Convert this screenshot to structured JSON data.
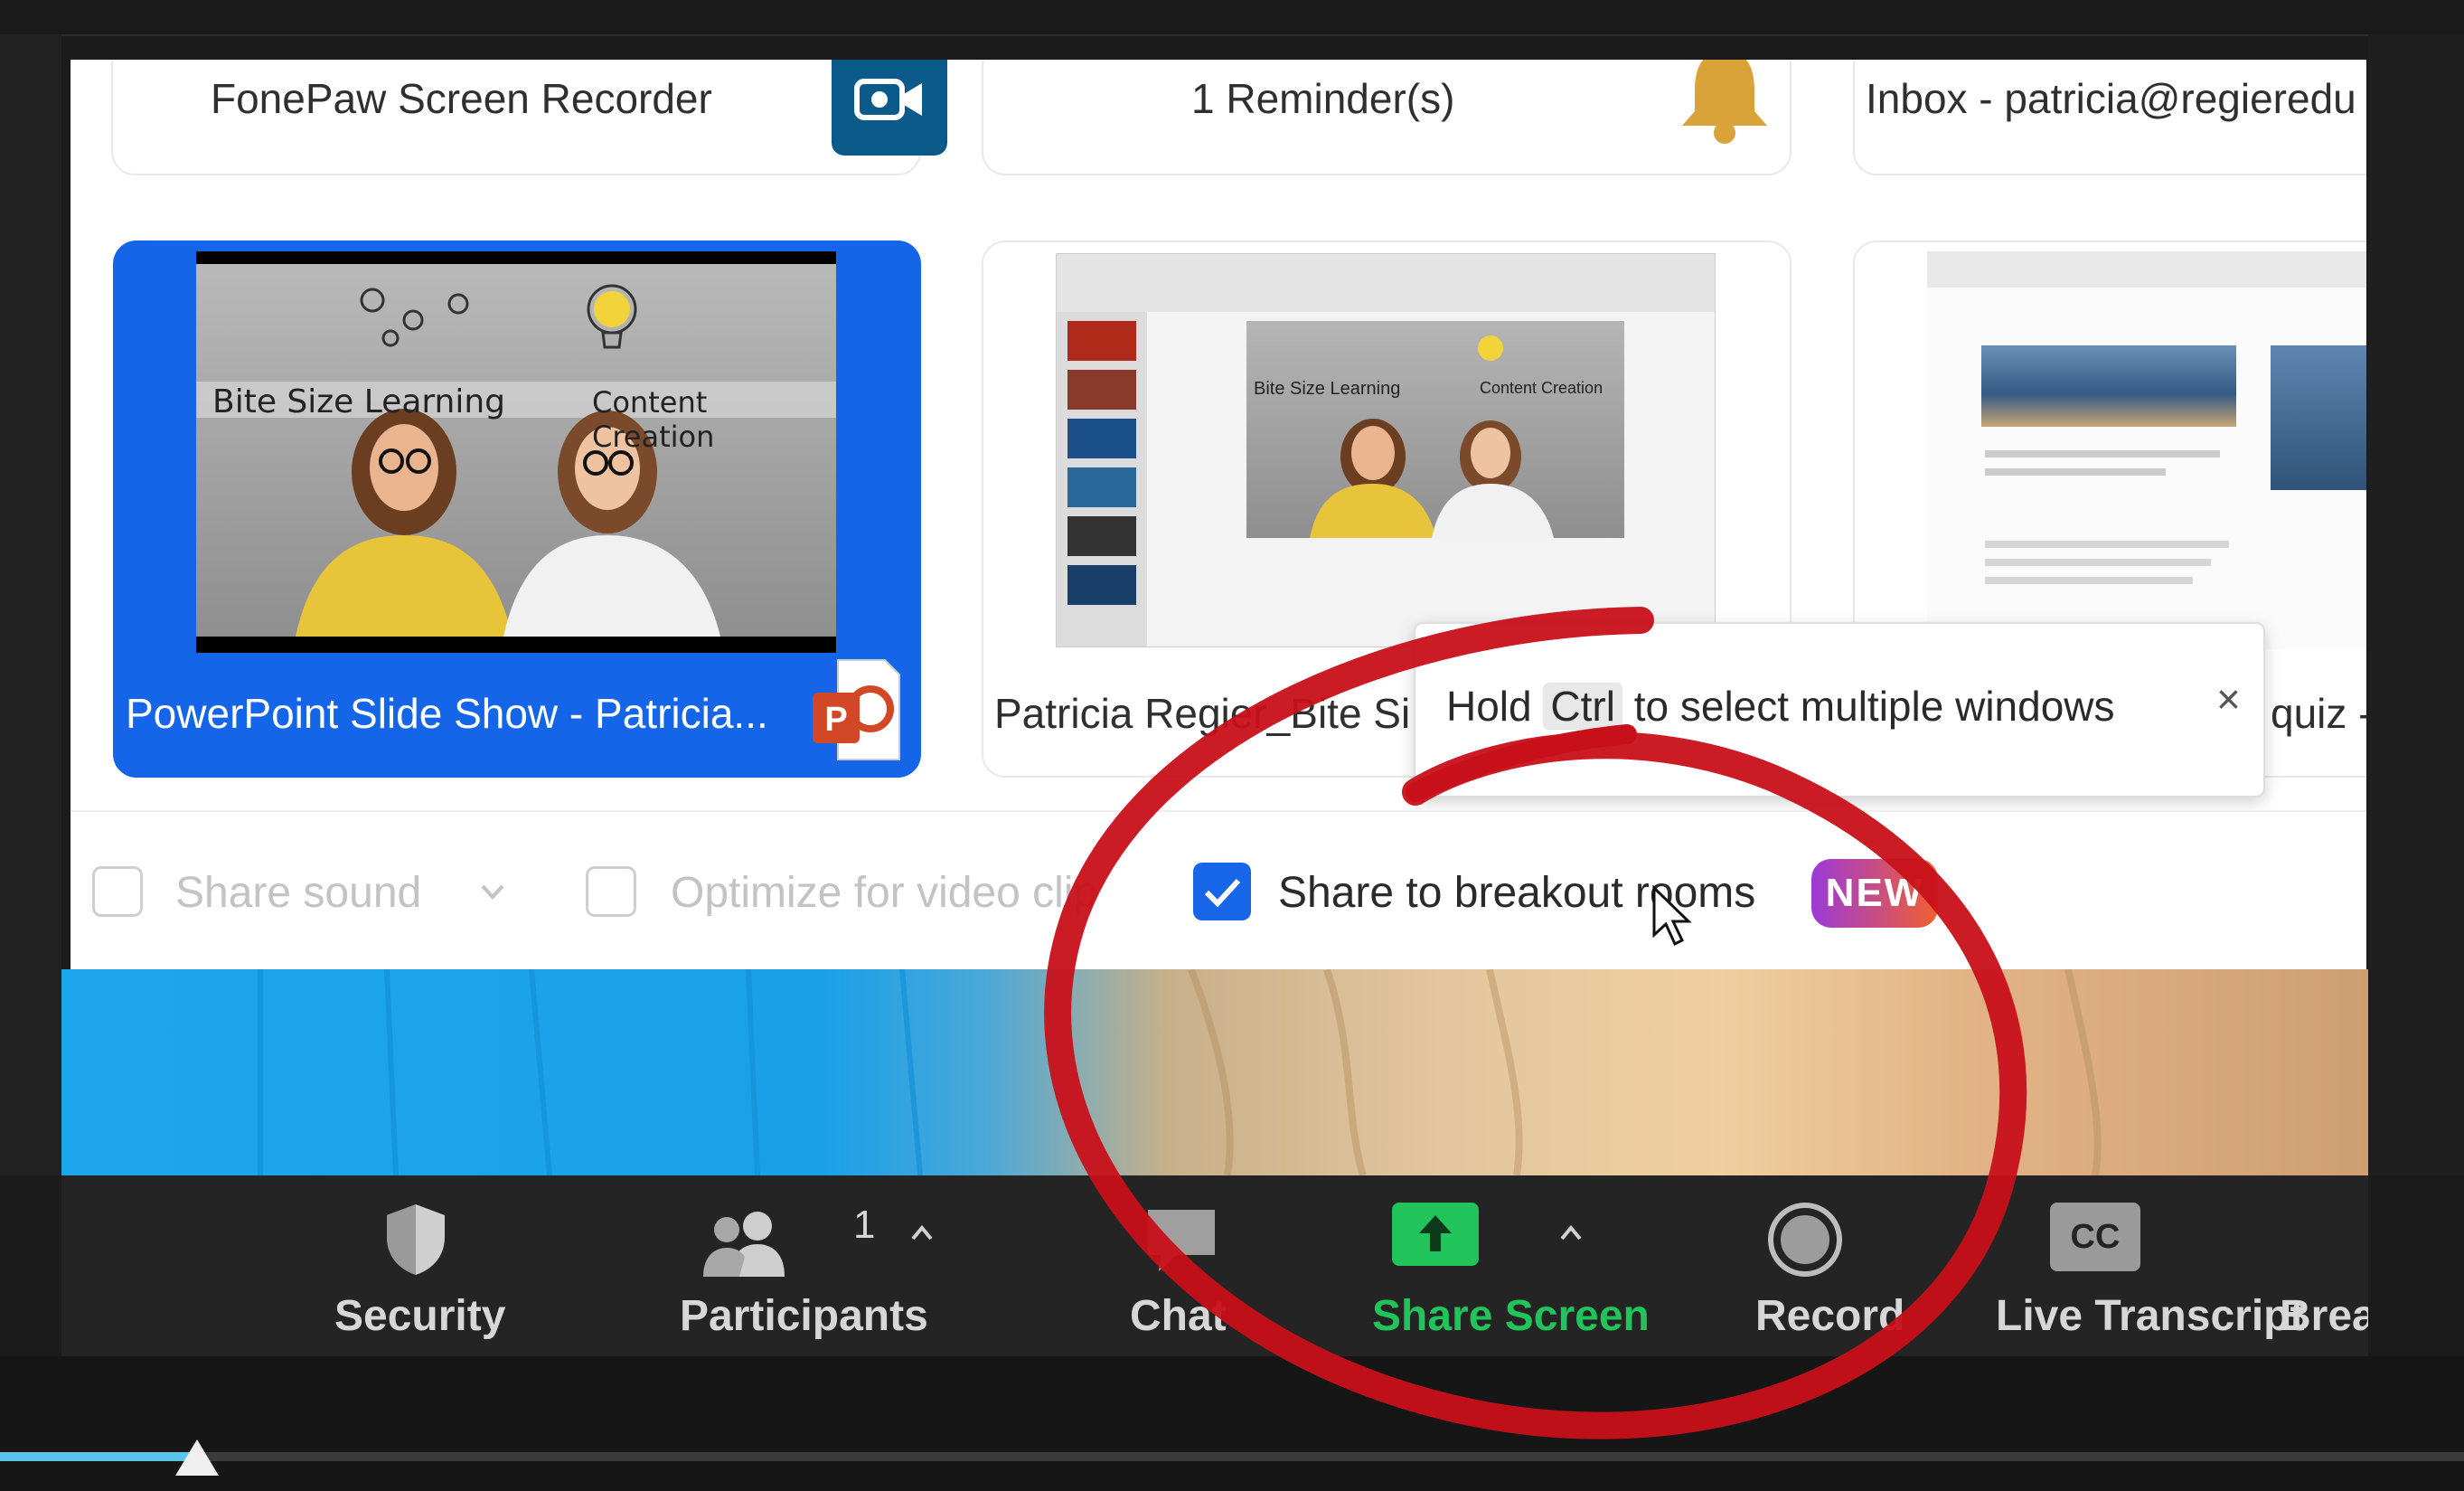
{
  "share_dialog": {
    "top_row": [
      {
        "label": "FonePaw Screen Recorder",
        "icon": "video-camera-icon",
        "icon_color": "#0a5a8a"
      },
      {
        "label": "1 Reminder(s)",
        "icon": "bell-icon",
        "icon_color": "#d9a33a"
      },
      {
        "label": "Inbox - patricia@regieredu",
        "icon": "outlook-icon"
      }
    ],
    "windows": [
      {
        "label": "PowerPoint Slide Show  -  Patricia...",
        "selected": true,
        "icon": "powerpoint-icon",
        "slide": {
          "left_title": "Bite Size Learning",
          "right_title": "Content Creation"
        }
      },
      {
        "label": "Patricia Regier_Bite Si",
        "selected": false,
        "slide": {
          "left_title": "Bite Size Learning",
          "right_title": "Content Creation"
        }
      },
      {
        "label": "quiz -",
        "selected": false
      }
    ],
    "tooltip": {
      "text_before": "Hold ",
      "key": "Ctrl",
      "text_after": " to select multiple windows",
      "close_glyph": "×"
    },
    "options": {
      "share_sound": {
        "label": "Share sound",
        "checked": false
      },
      "optimize_video": {
        "label": "Optimize for video clip",
        "checked": false
      },
      "share_breakout": {
        "label": "Share to breakout rooms",
        "checked": true,
        "badge": "NEW"
      }
    }
  },
  "toolbar": {
    "security": {
      "label": "Security"
    },
    "participants": {
      "label": "Participants",
      "count": "1"
    },
    "chat": {
      "label": "Chat"
    },
    "share_screen": {
      "label": "Share Screen",
      "color": "#21c45a"
    },
    "record": {
      "label": "Record"
    },
    "live_transcript": {
      "label": "Live Transcript",
      "icon_text": "CC"
    },
    "breakout": {
      "label": "Brea"
    }
  },
  "playback": {
    "progress_fraction": 0.08
  },
  "colors": {
    "accent_blue": "#1565e8",
    "annotation_red": "#c8101a",
    "toolbar_bg": "#242424"
  }
}
